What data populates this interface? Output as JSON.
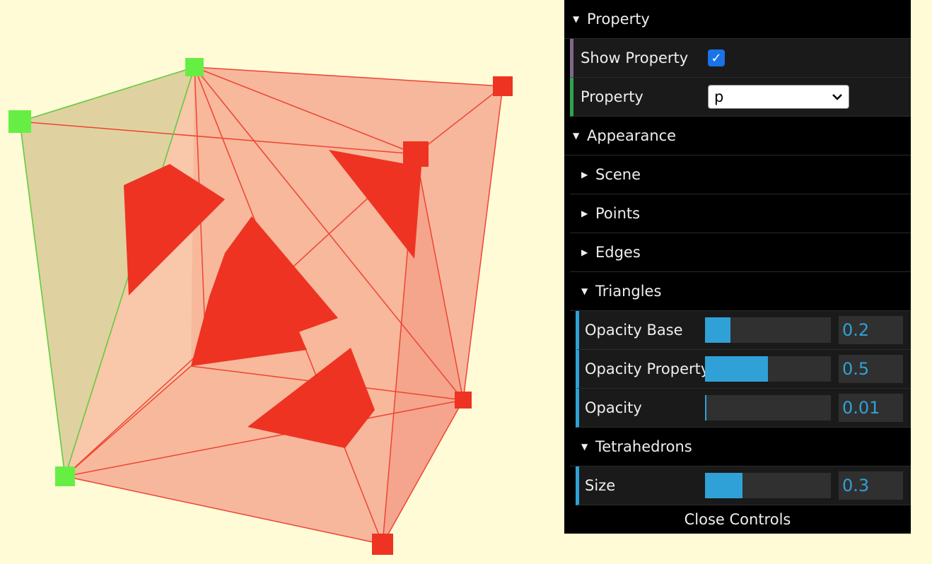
{
  "scene": {
    "background": "#fffbd6",
    "tet_color": "#ee3322",
    "face_color": "#f08070",
    "green_color": "#66ee44"
  },
  "gui": {
    "property_folder": "Property",
    "show_property_label": "Show Property",
    "show_property_checked": true,
    "property_label": "Property",
    "property_selected": "p",
    "appearance_folder": "Appearance",
    "scene_folder": "Scene",
    "points_folder": "Points",
    "edges_folder": "Edges",
    "triangles_folder": "Triangles",
    "opacity_base_label": "Opacity Base",
    "opacity_base_value": "0.2",
    "opacity_base_fraction": 0.2,
    "opacity_property_label": "Opacity Property",
    "opacity_property_value": "0.5",
    "opacity_property_fraction": 0.5,
    "opacity_label": "Opacity",
    "opacity_value": "0.01",
    "opacity_fraction": 0.01,
    "tetrahedrons_folder": "Tetrahedrons",
    "size_label": "Size",
    "size_value": "0.3",
    "size_fraction": 0.3,
    "close_controls": "Close Controls"
  }
}
